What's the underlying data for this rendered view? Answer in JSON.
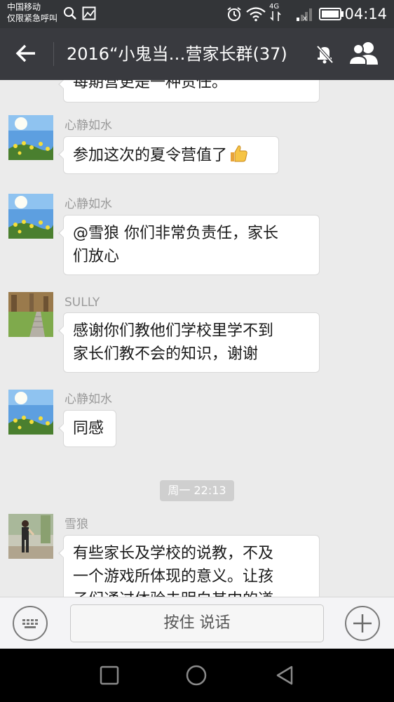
{
  "status_bar": {
    "carrier_line1": "中国移动",
    "carrier_line2": "仅限紧急呼叫",
    "network": "4G",
    "time": "04:14",
    "icons": [
      "search-icon",
      "gallery-icon",
      "alarm-icon",
      "wifi-icon",
      "signal-icon",
      "battery-icon"
    ]
  },
  "title_bar": {
    "title": "2016“小鬼当…营家长群(37)",
    "icons": [
      "back-arrow-icon",
      "mute-bell-icon",
      "group-members-icon"
    ]
  },
  "chat": {
    "partial_top_text": "每期营更是一种责任。",
    "messages": [
      {
        "sender": "心静如水",
        "lines": [
          "参加这次的夏令营值了"
        ],
        "emoji": "thumbs-up-icon"
      },
      {
        "sender": "心静如水",
        "lines": [
          "@雪狼 你们非常负责任，家长",
          "们放心"
        ]
      },
      {
        "sender": "SULLY",
        "lines": [
          "感谢你们教他们学校里学不到",
          "家长们教不会的知识，谢谢"
        ]
      },
      {
        "sender": "心静如水",
        "lines": [
          "同感"
        ]
      },
      {
        "sender": "雪狼",
        "lines": [
          "有些家长及学校的说教，不及",
          "一个游戏所体现的意义。让孩",
          "子们通过体验去明白其中的道"
        ]
      }
    ],
    "timestamp": "周一 22:13"
  },
  "input_bar": {
    "hold_to_talk": "按住 说话",
    "icons": [
      "keyboard-icon",
      "plus-icon"
    ]
  },
  "nav_bar": {
    "icons": [
      "recent-apps-icon",
      "home-icon",
      "back-triangle-icon"
    ]
  }
}
